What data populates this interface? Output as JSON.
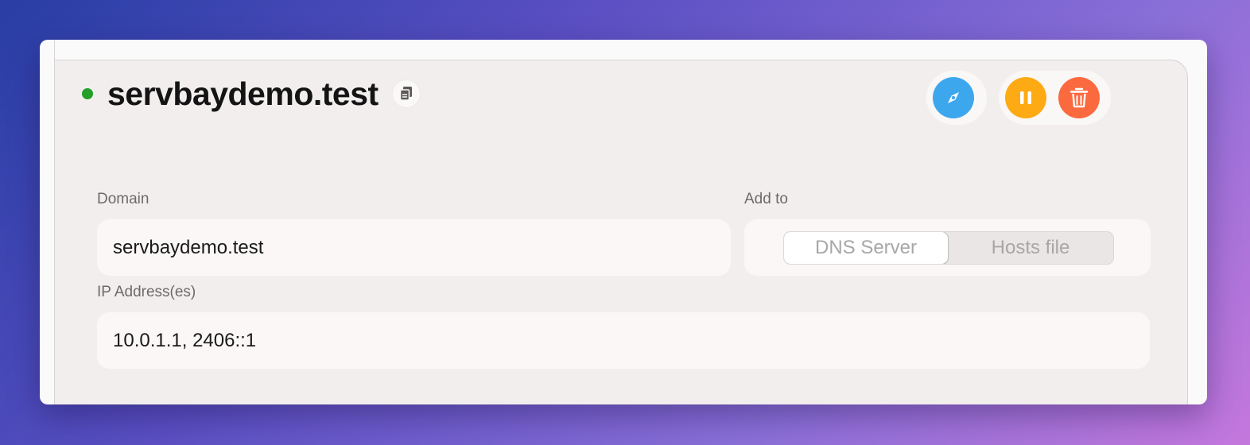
{
  "site": {
    "status_color": "#22a02a",
    "title": "servbaydemo.test",
    "copy_icon": "copy-icon"
  },
  "actions": {
    "open_icon": "compass-icon",
    "pause_icon": "pause-icon",
    "delete_icon": "trash-icon",
    "colors": {
      "open": "#3da7ee",
      "pause": "#fdaa14",
      "delete": "#fa6a3e"
    }
  },
  "form": {
    "domain_label": "Domain",
    "domain_value": "servbaydemo.test",
    "add_to_label": "Add to",
    "add_to_options": [
      "DNS Server",
      "Hosts file"
    ],
    "add_to_selected": "DNS Server",
    "ip_label": "IP Address(es)",
    "ip_value": "10.0.1.1, 2406::1"
  }
}
